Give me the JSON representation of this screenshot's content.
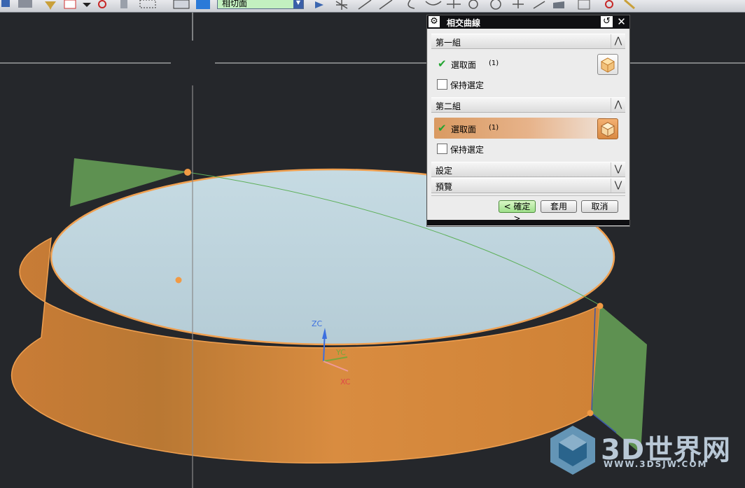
{
  "toolbar": {
    "filter_value": "相切面"
  },
  "viewport": {
    "axes": {
      "z": "ZC",
      "y": "YC",
      "x": "XC"
    },
    "colors": {
      "background": "#25272b",
      "cylinder_top": "#bfd5de",
      "cylinder_side": "#d4883b",
      "plane": "#5e9151",
      "highlight": "#f19a44"
    }
  },
  "dialog": {
    "title": "相交曲線",
    "section1": {
      "label": "第一組",
      "select_face": "選取面",
      "count": "(1)",
      "keep_selected": "保持選定"
    },
    "section2": {
      "label": "第二組",
      "select_face": "選取面",
      "count": "(1)",
      "keep_selected": "保持選定"
    },
    "settings_label": "設定",
    "preview_label": "預覽",
    "buttons": {
      "ok": "< 確定 >",
      "apply": "套用",
      "cancel": "取消"
    }
  },
  "watermark": {
    "logo_text": "3D世界网",
    "url": "WWW.3DSJW.COM"
  }
}
